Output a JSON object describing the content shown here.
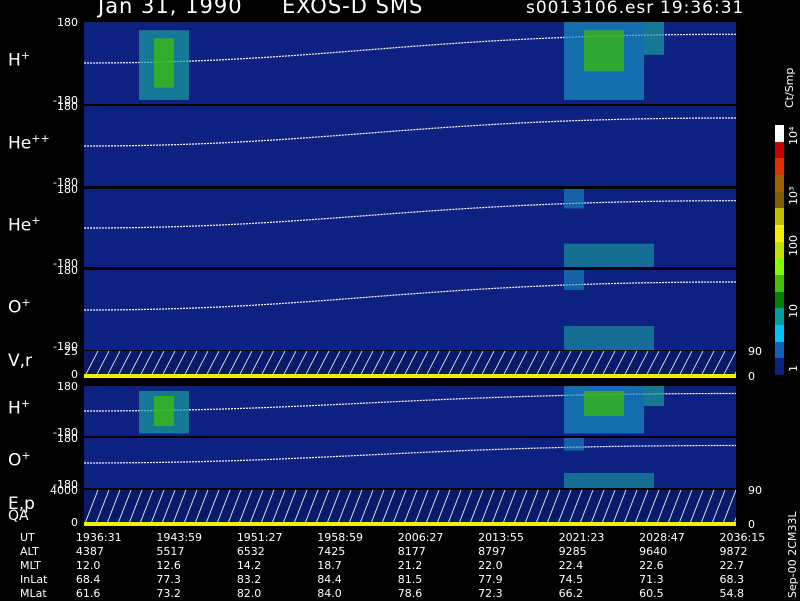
{
  "header": {
    "date": "Jan 31, 1990",
    "instrument": "EXOS-D SMS",
    "file": "s0013106.esr",
    "time": "19:36:31"
  },
  "panels": [
    {
      "label": "H",
      "sup": "+",
      "top_tick": "180",
      "bottom_tick": "-180"
    },
    {
      "label": "He",
      "sup": "++",
      "top_tick": "180",
      "bottom_tick": "-180"
    },
    {
      "label": "He",
      "sup": "+",
      "top_tick": "180",
      "bottom_tick": "-180"
    },
    {
      "label": "O",
      "sup": "+",
      "top_tick": "180",
      "bottom_tick": "-180"
    },
    {
      "label": "V,r",
      "sup": "",
      "top_tick": "25",
      "bottom_tick": "0",
      "right_top": "90",
      "right_bottom": "0"
    },
    {
      "label": "H",
      "sup": "+",
      "top_tick": "180",
      "bottom_tick": "-180"
    },
    {
      "label": "O",
      "sup": "+",
      "top_tick": "180",
      "bottom_tick": "-180"
    },
    {
      "label": "E,p",
      "sup": "",
      "label2": "QA",
      "top_tick": "4000",
      "bottom_tick": "0",
      "right_top": "90",
      "right_bottom": "0"
    }
  ],
  "colorbar": {
    "units": "Ct/Smp",
    "labels": [
      "10⁴",
      "10³",
      "100",
      "10",
      "1"
    ],
    "colors": [
      "#ffffff",
      "#c80000",
      "#e03000",
      "#a06000",
      "#806000",
      "#c0c000",
      "#f0f000",
      "#c0e000",
      "#80ff00",
      "#40c000",
      "#008000",
      "#00a0a0",
      "#00c0ff",
      "#1060c0",
      "#0d2181"
    ]
  },
  "ephemeris": {
    "rows": [
      {
        "name": "UT",
        "values": [
          "1936:31",
          "1943:59",
          "1951:27",
          "1958:59",
          "2006:27",
          "2013:55",
          "2021:23",
          "2028:47",
          "2036:15"
        ]
      },
      {
        "name": "ALT",
        "values": [
          "4387",
          "5517",
          "6532",
          "7425",
          "8177",
          "8797",
          "9285",
          "9640",
          "9872"
        ]
      },
      {
        "name": "MLT",
        "values": [
          "12.0",
          "12.6",
          "14.2",
          "18.7",
          "21.2",
          "22.0",
          "22.4",
          "22.6",
          "22.7"
        ]
      },
      {
        "name": "InLat",
        "values": [
          "68.4",
          "77.3",
          "83.2",
          "84.4",
          "81.5",
          "77.9",
          "74.5",
          "71.3",
          "68.3"
        ]
      },
      {
        "name": "MLat",
        "values": [
          "61.6",
          "73.2",
          "82.0",
          "84.0",
          "78.6",
          "72.3",
          "66.2",
          "60.5",
          "54.8"
        ]
      }
    ]
  },
  "footer_caption": "Sep-00 2CM33L",
  "chart_data": {
    "type": "heatmap",
    "x_ticks": [
      "1936:31",
      "1943:59",
      "1951:27",
      "1958:59",
      "2006:27",
      "2013:55",
      "2021:23",
      "2028:47",
      "2036:15"
    ],
    "y_range": [
      -180,
      180
    ],
    "color_scale": "log",
    "color_range": [
      "1",
      "10⁴"
    ]
  }
}
